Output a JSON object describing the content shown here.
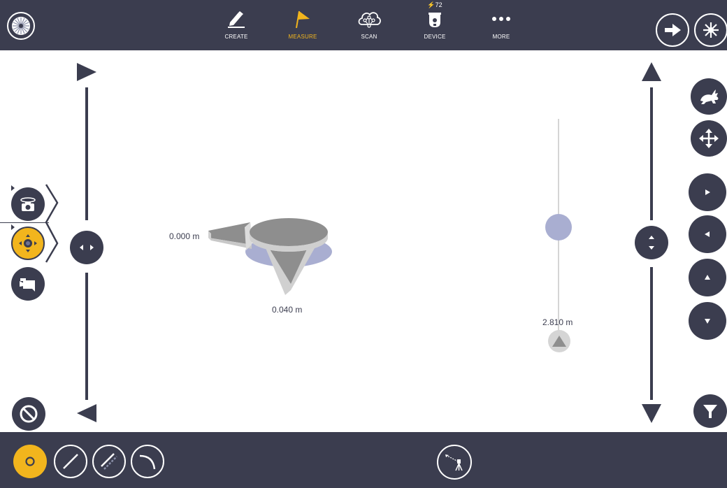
{
  "toolbar": {
    "items": [
      {
        "label": "CREATE",
        "icon": "pencil-icon"
      },
      {
        "label": "MEASURE",
        "icon": "flag-icon",
        "active": true
      },
      {
        "label": "SCAN",
        "icon": "cloud-network-icon"
      },
      {
        "label": "DEVICE",
        "icon": "instrument-icon",
        "badge": "⚡72"
      },
      {
        "label": "MORE",
        "icon": "more-dots-icon"
      }
    ]
  },
  "measurements": {
    "left": "0.000 m",
    "bottom": "0.040 m",
    "height": "2.810 m"
  },
  "colors": {
    "bar": "#3b3d4f",
    "accent": "#f2b51d",
    "target_gray": "#8e8e8e",
    "target_blue": "#a9aed1"
  }
}
